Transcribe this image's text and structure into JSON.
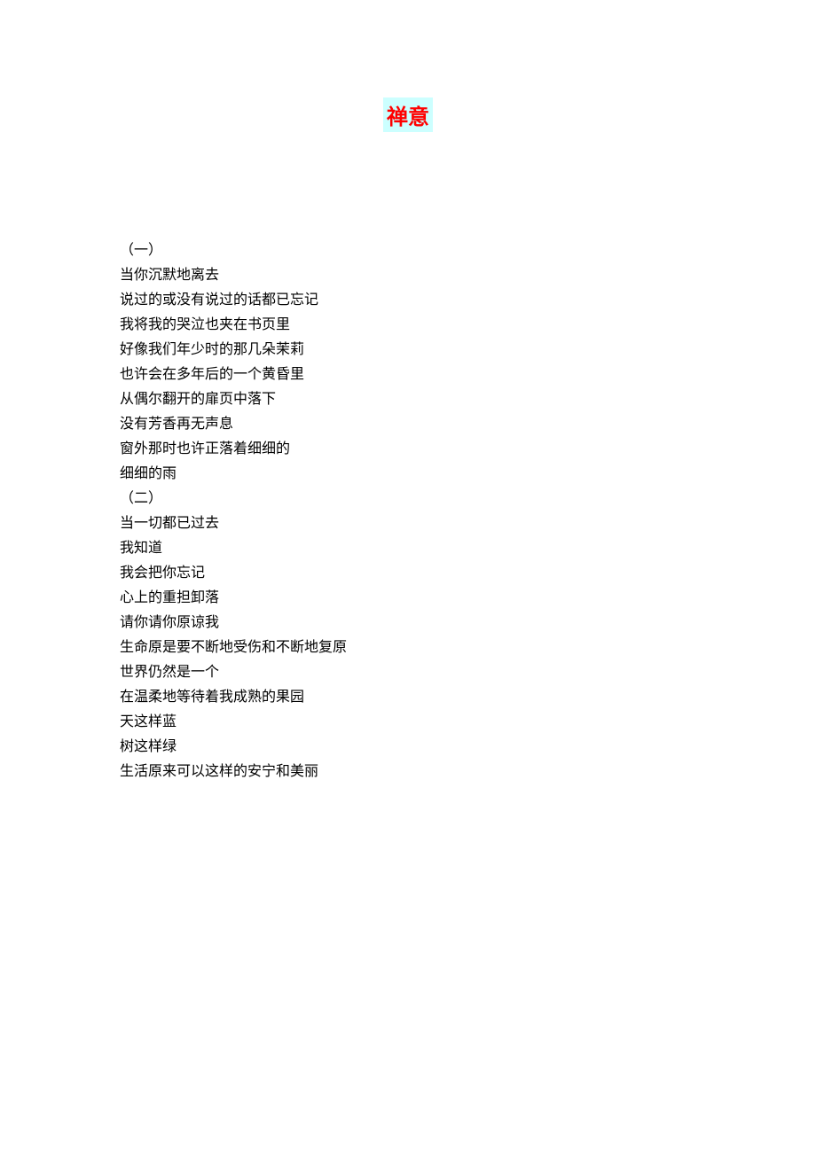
{
  "title": "禅意",
  "lines": [
    "（一）",
    "当你沉默地离去",
    "说过的或没有说过的话都已忘记",
    "我将我的哭泣也夹在书页里",
    "好像我们年少时的那几朵茉莉",
    "也许会在多年后的一个黄昏里",
    "从偶尔翻开的扉页中落下",
    "没有芳香再无声息",
    "窗外那时也许正落着细细的",
    "细细的雨",
    "（二）",
    "当一切都已过去",
    "我知道",
    "我会把你忘记",
    "心上的重担卸落",
    "请你请你原谅我",
    "生命原是要不断地受伤和不断地复原",
    "世界仍然是一个",
    "在温柔地等待着我成熟的果园",
    "天这样蓝",
    "树这样绿",
    "生活原来可以这样的安宁和美丽"
  ]
}
